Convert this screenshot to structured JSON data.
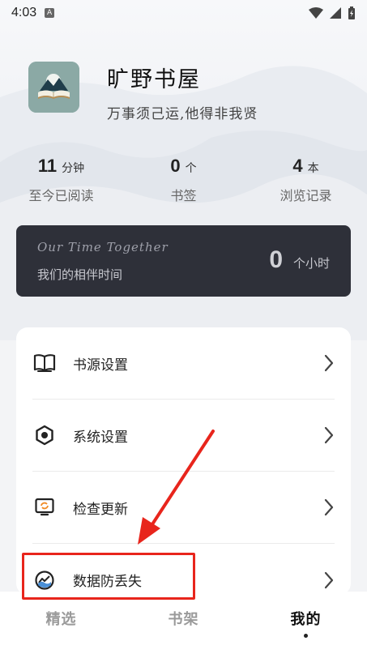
{
  "status_bar": {
    "time": "4:03",
    "indicator": "A"
  },
  "profile": {
    "app_name": "旷野书屋",
    "motto": "万事须己运,他得非我贤"
  },
  "stats": [
    {
      "value": "11",
      "unit": "分钟",
      "label": "至今已阅读"
    },
    {
      "value": "0",
      "unit": "个",
      "label": "书签"
    },
    {
      "value": "4",
      "unit": "本",
      "label": "浏览记录"
    }
  ],
  "together": {
    "title_en": "Our Time Together",
    "title_cn": "我们的相伴时间",
    "value": "0",
    "unit": "个小时"
  },
  "menu": {
    "items": [
      {
        "label": "书源设置",
        "icon": "book-icon"
      },
      {
        "label": "系统设置",
        "icon": "gear-icon"
      },
      {
        "label": "检查更新",
        "icon": "update-icon"
      },
      {
        "label": "数据防丢失",
        "icon": "backup-icon"
      }
    ]
  },
  "bottom_nav": {
    "tabs": [
      {
        "label": "精选",
        "active": false
      },
      {
        "label": "书架",
        "active": false
      },
      {
        "label": "我的",
        "active": true
      }
    ]
  },
  "annotation": {
    "color": "#e8251c"
  }
}
